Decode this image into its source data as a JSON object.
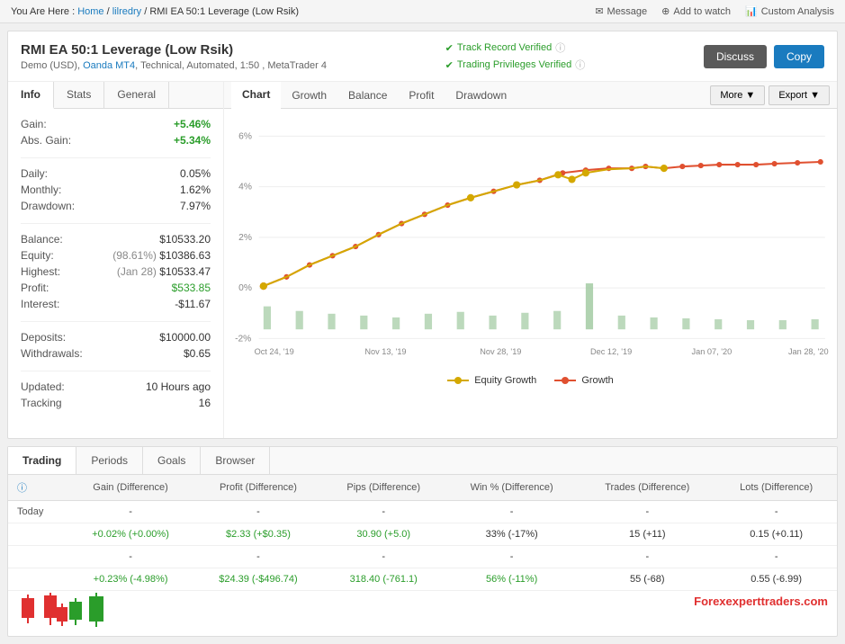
{
  "breadcrumb": {
    "you_are_here": "You Are Here :",
    "home": "Home",
    "separator1": "/",
    "user": "lilredry",
    "separator2": "/",
    "page": "RMI EA 50:1 Leverage (Low Rsik)"
  },
  "actions": {
    "message": "Message",
    "add_to_watch": "Add to watch",
    "custom_analysis": "Custom Analysis"
  },
  "profile": {
    "title": "RMI EA 50:1 Leverage (Low Rsik)",
    "meta": "Demo (USD), Oanda MT4, Technical, Automated, 1:50 , MetaTrader 4",
    "badge1": "Track Record Verified",
    "badge2": "Trading Privileges Verified",
    "btn_discuss": "Discuss",
    "btn_copy": "Copy"
  },
  "left_tabs": [
    "Info",
    "Stats",
    "General"
  ],
  "stats": {
    "gain_label": "Gain:",
    "gain_value": "+5.46%",
    "abs_gain_label": "Abs. Gain:",
    "abs_gain_value": "+5.34%",
    "daily_label": "Daily:",
    "daily_value": "0.05%",
    "monthly_label": "Monthly:",
    "monthly_value": "1.62%",
    "drawdown_label": "Drawdown:",
    "drawdown_value": "7.97%",
    "balance_label": "Balance:",
    "balance_value": "$10533.20",
    "equity_label": "Equity:",
    "equity_pct": "(98.61%)",
    "equity_value": "$10386.63",
    "highest_label": "Highest:",
    "highest_date": "(Jan 28)",
    "highest_value": "$10533.47",
    "profit_label": "Profit:",
    "profit_value": "$533.85",
    "interest_label": "Interest:",
    "interest_value": "-$11.67",
    "deposits_label": "Deposits:",
    "deposits_value": "$10000.00",
    "withdrawals_label": "Withdrawals:",
    "withdrawals_value": "$0.65",
    "updated_label": "Updated:",
    "updated_value": "10 Hours ago",
    "tracking_label": "Tracking",
    "tracking_value": "16"
  },
  "chart_tabs": [
    "Chart",
    "Growth",
    "Balance",
    "Profit",
    "Drawdown"
  ],
  "chart_controls": {
    "more": "More",
    "export": "Export"
  },
  "chart": {
    "y_labels": [
      "6%",
      "4%",
      "2%",
      "0%",
      "-2%"
    ],
    "x_labels": [
      "Oct 24, '19",
      "Nov 13, '19",
      "Nov 28, '19",
      "Dec 12, '19",
      "Jan 07, '20",
      "Jan 28, '20"
    ],
    "legend_equity": "Equity Growth",
    "legend_growth": "Growth"
  },
  "bottom_tabs": [
    "Trading",
    "Periods",
    "Goals",
    "Browser"
  ],
  "table": {
    "headers": [
      "",
      "Gain (Difference)",
      "Profit (Difference)",
      "Pips (Difference)",
      "Win % (Difference)",
      "Trades (Difference)",
      "Lots (Difference)"
    ],
    "rows": [
      {
        "label": "Today",
        "gain": "-",
        "profit": "-",
        "pips": "-",
        "win": "-",
        "trades": "-",
        "lots": "-"
      },
      {
        "label": "",
        "gain": "+0.02% (+0.00%)",
        "gain_green": true,
        "profit": "$2.33 (+$0.35)",
        "profit_green": true,
        "pips": "30.90 (+5.0)",
        "pips_green": true,
        "win": "33% (-17%)",
        "win_green": false,
        "trades": "15 (+11)",
        "lots": "0.15 (+0.11)"
      },
      {
        "label": "",
        "gain": "-",
        "profit": "-",
        "pips": "-",
        "win": "-",
        "trades": "-",
        "lots": "-"
      },
      {
        "label": "",
        "gain": "+0.23% (-4.98%)",
        "gain_green": true,
        "profit": "$24.39 (-$496.74)",
        "profit_green": true,
        "pips": "318.40 (-761.1)",
        "pips_green": true,
        "win": "56% (-11%)",
        "win_green": true,
        "trades": "55 (-68)",
        "lots": "0.55 (-6.99)"
      }
    ]
  },
  "watermark": {
    "text": "Forexperttraders.com",
    "red_part": "Forex"
  }
}
